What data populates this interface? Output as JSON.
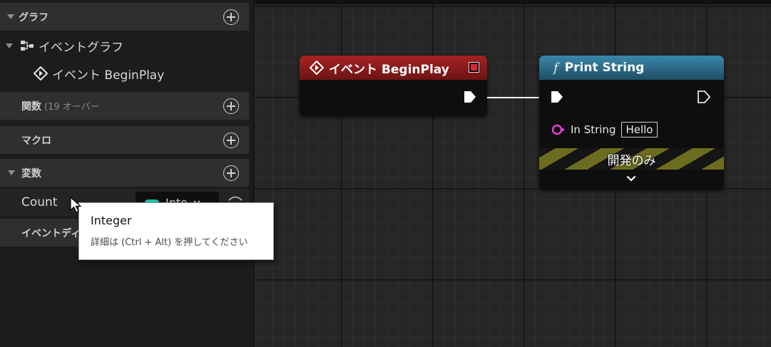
{
  "sidebar": {
    "graphs_section": {
      "title": "グラフ"
    },
    "event_graph": {
      "label": "イベントグラフ"
    },
    "event_beginplay": {
      "label": "イベント BeginPlay"
    },
    "functions_section": {
      "title": "関数",
      "sub": "(19 オーバー"
    },
    "macros_section": {
      "title": "マクロ"
    },
    "variables_section": {
      "title": "変数"
    },
    "variable_count": {
      "name": "Count",
      "type": "Inte"
    },
    "dispatchers_section": {
      "title": "イベントディ"
    }
  },
  "tooltip": {
    "title": "Integer",
    "hint": "詳細は (Ctrl + Alt) を押してください"
  },
  "nodes": {
    "beginplay": {
      "title": "イベント BeginPlay",
      "color": "#8c1b1b"
    },
    "print_string": {
      "function_glyph": "f",
      "title": "Print String",
      "color": "#2f6f8f",
      "in_string_label": "In String",
      "in_string_value": "Hello",
      "dev_only_label": "開発のみ"
    }
  },
  "colors": {
    "panel_bg": "#1c1c1c",
    "section_bg": "#2f2f2f",
    "graph_bg": "#262626",
    "integer_pin": "#1fc5b8",
    "string_pin": "#e23fd1"
  }
}
